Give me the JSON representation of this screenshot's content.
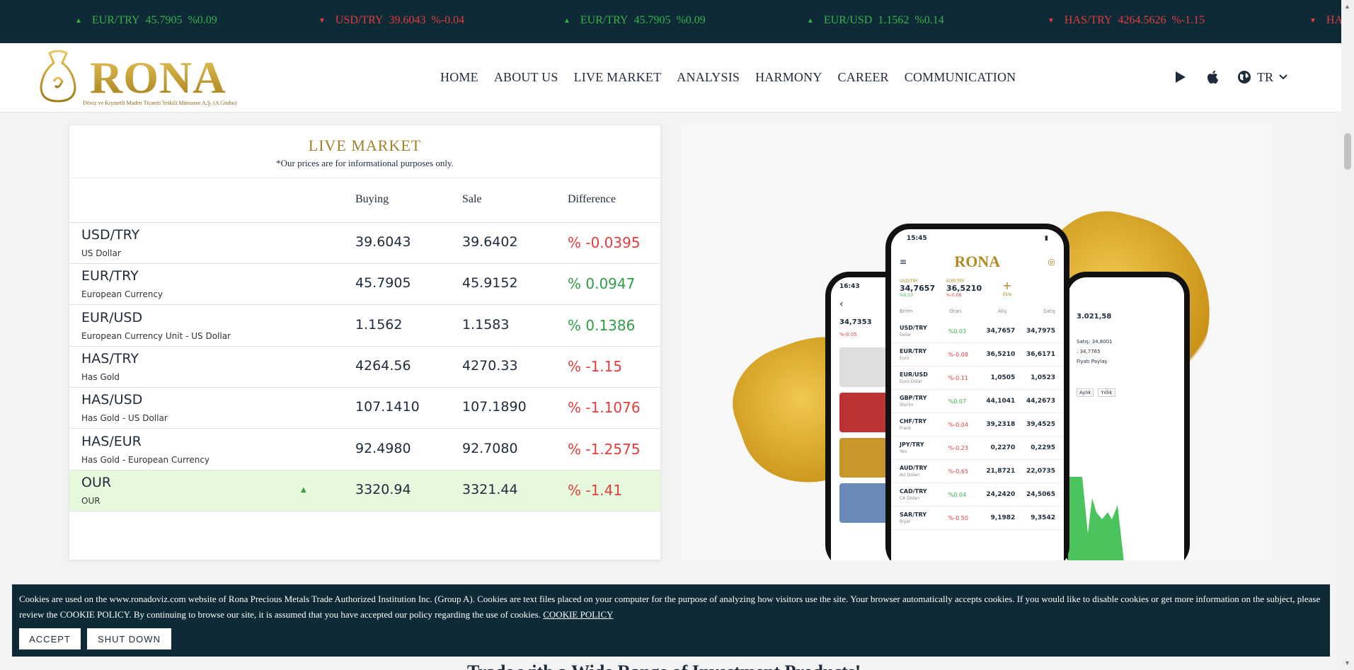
{
  "ticker": [
    {
      "pair": "EUR/TRY",
      "price": "45.7905",
      "change": "%0.09",
      "dir": "up"
    },
    {
      "pair": "USD/TRY",
      "price": "39.6043",
      "change": "%-0.04",
      "dir": "down"
    },
    {
      "pair": "EUR/TRY",
      "price": "45.7905",
      "change": "%0.09",
      "dir": "up"
    },
    {
      "pair": "EUR/USD",
      "price": "1.1562",
      "change": "%0.14",
      "dir": "up"
    },
    {
      "pair": "HAS/TRY",
      "price": "4264.5626",
      "change": "%-1.15",
      "dir": "down"
    },
    {
      "pair": "HAS",
      "price": "",
      "change": "",
      "dir": "down"
    }
  ],
  "header": {
    "logo_text": "RONA",
    "logo_sub": "Döviz ve Kıymetli Maden Ticareti Yetkili Müessese A.Ş. (A Grubu)",
    "nav": [
      "HOME",
      "ABOUT US",
      "LIVE MARKET",
      "ANALYSIS",
      "HARMONY",
      "CAREER",
      "COMMUNICATION"
    ],
    "lang": "TR",
    "icons": [
      "play-store-icon",
      "apple-icon",
      "globe-icon",
      "chevron-down-icon"
    ]
  },
  "market": {
    "title": "LIVE MARKET",
    "note": "*Our prices are for informational purposes only.",
    "columns": {
      "buying": "Buying",
      "sale": "Sale",
      "difference": "Difference"
    },
    "rows": [
      {
        "symbol": "USD/TRY",
        "name": "US Dollar",
        "buying": "39.6043",
        "sale": "39.6402",
        "difference": "% -0.0395",
        "sign": "neg",
        "highlight": false
      },
      {
        "symbol": "EUR/TRY",
        "name": "European Currency",
        "buying": "45.7905",
        "sale": "45.9152",
        "difference": "% 0.0947",
        "sign": "pos",
        "highlight": false
      },
      {
        "symbol": "EUR/USD",
        "name": "European Currency Unit - US Dollar",
        "buying": "1.1562",
        "sale": "1.1583",
        "difference": "% 0.1386",
        "sign": "pos",
        "highlight": false
      },
      {
        "symbol": "HAS/TRY",
        "name": "Has Gold",
        "buying": "4264.56",
        "sale": "4270.33",
        "difference": "% -1.15",
        "sign": "neg",
        "highlight": false
      },
      {
        "symbol": "HAS/USD",
        "name": "Has Gold - US Dollar",
        "buying": "107.1410",
        "sale": "107.1890",
        "difference": "% -1.1076",
        "sign": "neg",
        "highlight": false
      },
      {
        "symbol": "HAS/EUR",
        "name": "Has Gold - European Currency",
        "buying": "92.4980",
        "sale": "92.7080",
        "difference": "% -1.2575",
        "sign": "neg",
        "highlight": false
      },
      {
        "symbol": "OUR",
        "name": "OUR",
        "buying": "3320.94",
        "sale": "3321.44",
        "difference": "% -1.41",
        "sign": "neg",
        "highlight": true
      }
    ]
  },
  "app_preview": {
    "time_left": "16:43",
    "time_center": "15:45",
    "brand": "RONA",
    "top_cards": [
      {
        "pair": "USD/TRY",
        "value": "34,7657",
        "change": "%0.03"
      },
      {
        "pair": "EUR/TRY",
        "value": "36,5210",
        "change": "%-0.08"
      }
    ],
    "add_label": "Ekle",
    "headers": [
      "Birim",
      "Oran",
      "Alış",
      "Satış"
    ],
    "rows": [
      {
        "sym": "USD/TRY",
        "sub": "Dolar",
        "d": "%0.03",
        "a": "34,7657",
        "s": "34,7975",
        "sign": "pos"
      },
      {
        "sym": "EUR/TRY",
        "sub": "Euro",
        "d": "%-0.08",
        "a": "36,5210",
        "s": "36,6171",
        "sign": "neg"
      },
      {
        "sym": "EUR/USD",
        "sub": "Euro-Dolar",
        "d": "%-0.11",
        "a": "1,0505",
        "s": "1,0523",
        "sign": "neg"
      },
      {
        "sym": "GBP/TRY",
        "sub": "Sterlin",
        "d": "%0.07",
        "a": "44,1041",
        "s": "44,2673",
        "sign": "pos"
      },
      {
        "sym": "CHF/TRY",
        "sub": "Frank",
        "d": "%-0.04",
        "a": "39,2318",
        "s": "39,4525",
        "sign": "neg"
      },
      {
        "sym": "JPY/TRY",
        "sub": "Yen",
        "d": "%-0.23",
        "a": "0,2270",
        "s": "0,2295",
        "sign": "neg"
      },
      {
        "sym": "AUD/TRY",
        "sub": "AU Doları",
        "d": "%-0.65",
        "a": "21,8721",
        "s": "22,0735",
        "sign": "neg"
      },
      {
        "sym": "CAD/TRY",
        "sub": "CA Doları",
        "d": "%0.04",
        "a": "24,2420",
        "s": "24,5065",
        "sign": "pos"
      },
      {
        "sym": "SAR/TRY",
        "sub": "Riyal",
        "d": "%-0.50",
        "a": "9,1982",
        "s": "9,3542",
        "sign": "neg"
      }
    ],
    "right_value": "3.021,58",
    "right_sale": "Satış: 34,8001",
    "right_buy": ": 34,7765",
    "share_label": "Fiyatı Paylaş",
    "chart_tabs": [
      "Aylık",
      "Yıllık"
    ],
    "left_value": "34,7353",
    "left_change": "%-0.05"
  },
  "cookie": {
    "text": "Cookies are used on the www.ronadoviz.com website of Rona Precious Metals Trade Authorized Institution Inc. (Group A). Cookies are text files placed on your computer for the purpose of analyzing how visitors use the site. Your browser automatically accepts cookies. If you would like to disable cookies or get more information on the subject, please review the COOKIE POLICY. By continuing to browse our site, it is assumed that you have accepted our policy regarding the use of cookies.",
    "policy_link": "COOKIE POLICY",
    "accept": "ACCEPT",
    "shutdown": "SHUT DOWN"
  },
  "bottom_heading": "Trade with a Wide Range of Investment Products!",
  "colors": {
    "navy": "#0d2a36",
    "gold": "#b08a1f",
    "up": "#38b24a",
    "down": "#e53c3c"
  }
}
